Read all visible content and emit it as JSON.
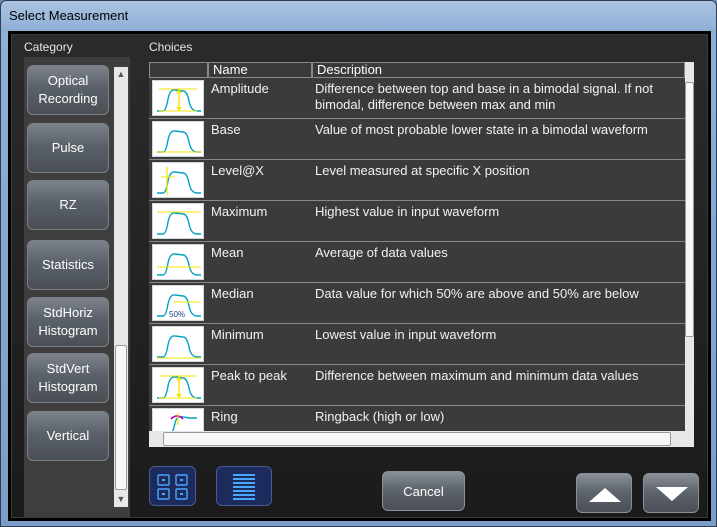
{
  "window": {
    "title": "Select Measurement"
  },
  "category": {
    "header": "Category",
    "items": [
      {
        "label": "Optical\nRecording"
      },
      {
        "label": "Pulse"
      },
      {
        "label": "RZ"
      },
      {
        "label": "Statistics"
      },
      {
        "label": "StdHoriz\nHistogram"
      },
      {
        "label": "StdVert\nHistogram"
      },
      {
        "label": "Vertical"
      }
    ]
  },
  "choices": {
    "header": "Choices",
    "columns": {
      "name": "Name",
      "description": "Description"
    },
    "rows": [
      {
        "icon": "amplitude-icon",
        "name": "Amplitude",
        "description": "Difference between top and base in a bimodal signal.  If not bimodal, difference between max and min"
      },
      {
        "icon": "base-icon",
        "name": "Base",
        "description": "Value of most probable lower state in a bimodal waveform"
      },
      {
        "icon": "level-at-x-icon",
        "name": "Level@X",
        "description": "Level measured at specific X position"
      },
      {
        "icon": "maximum-icon",
        "name": "Maximum",
        "description": "Highest value in input waveform"
      },
      {
        "icon": "mean-icon",
        "name": "Mean",
        "description": "Average of data values"
      },
      {
        "icon": "median-icon",
        "name": "Median",
        "description": "Data value for which 50% are above and 50% are below",
        "icon_text": "50%"
      },
      {
        "icon": "minimum-icon",
        "name": "Minimum",
        "description": "Lowest value in input waveform"
      },
      {
        "icon": "peak-to-peak-icon",
        "name": "Peak to peak",
        "description": "Difference between maximum and minimum data values"
      },
      {
        "icon": "ring-icon",
        "name": "Ring",
        "description": "Ringback (high or low)"
      }
    ]
  },
  "buttons": {
    "cancel": "Cancel"
  },
  "colors": {
    "panel_bg": "#2b2b2b",
    "waveform": "#00a2c8",
    "marker": "#f5e400",
    "ring": "#c000c0"
  }
}
